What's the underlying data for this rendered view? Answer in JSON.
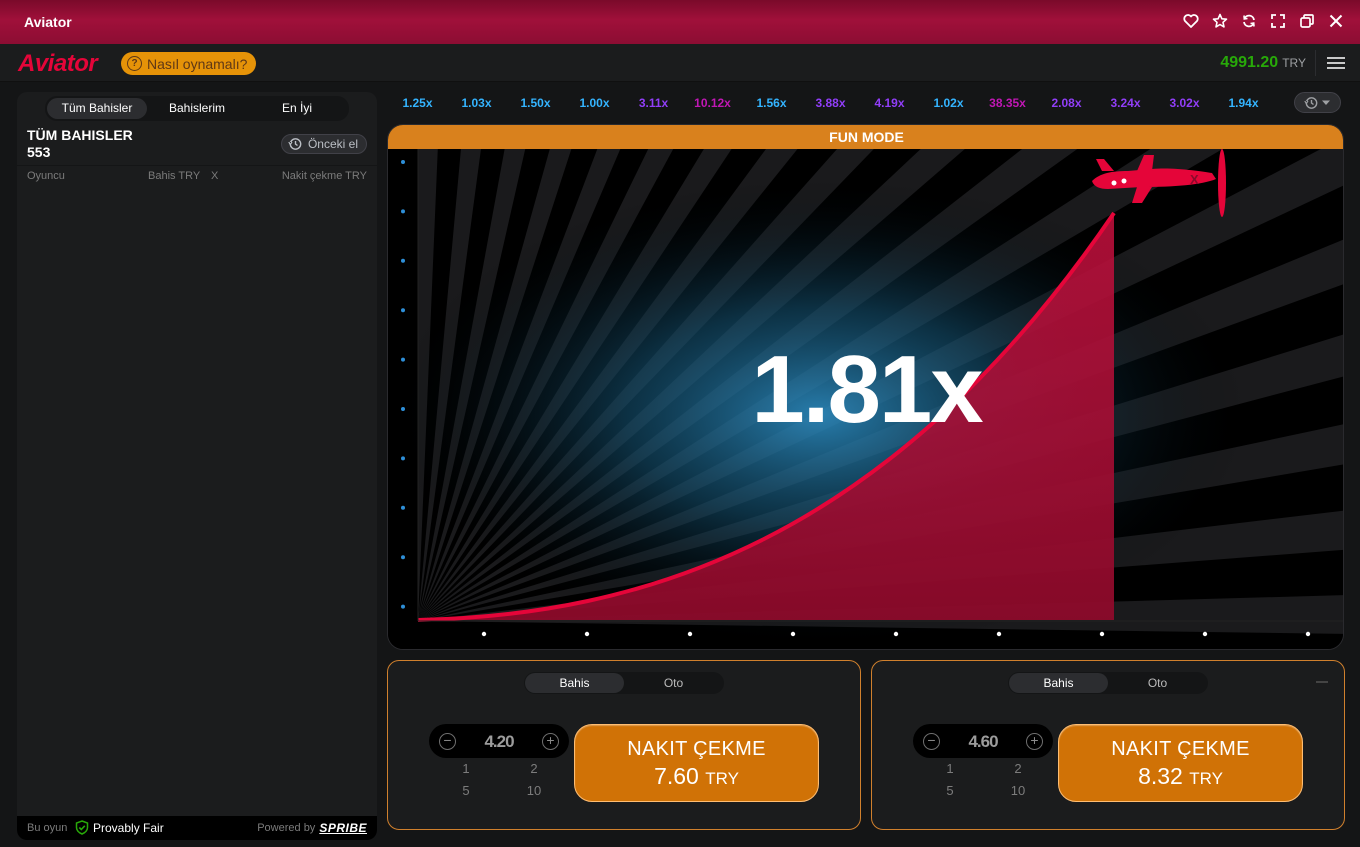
{
  "window": {
    "title": "Aviator"
  },
  "header": {
    "logo": "Aviator",
    "how_to_play": "Nasıl oynamalı?",
    "balance": "4991.20",
    "currency": "TRY"
  },
  "left_panel": {
    "tabs": [
      {
        "label": "Tüm Bahisler",
        "active": true
      },
      {
        "label": "Bahislerim",
        "active": false
      },
      {
        "label": "En İyi",
        "active": false
      }
    ],
    "title": "TÜM BAHISLER",
    "count": "553",
    "previous_hand": "Önceki el",
    "columns": {
      "player": "Oyuncu",
      "bet": "Bahis TRY",
      "x": "X",
      "cashout": "Nakit çekme TRY"
    },
    "footer": {
      "this_game": "Bu oyun",
      "provably_fair": "Provably Fair",
      "powered_by": "Powered by",
      "brand": "SPRIBE"
    }
  },
  "history": [
    {
      "value": "1.25x",
      "color": "#34b4ff"
    },
    {
      "value": "1.03x",
      "color": "#34b4ff"
    },
    {
      "value": "1.50x",
      "color": "#34b4ff"
    },
    {
      "value": "1.00x",
      "color": "#34b4ff"
    },
    {
      "value": "3.11x",
      "color": "#913ef8"
    },
    {
      "value": "10.12x",
      "color": "#c017b4"
    },
    {
      "value": "1.56x",
      "color": "#34b4ff"
    },
    {
      "value": "3.88x",
      "color": "#913ef8"
    },
    {
      "value": "4.19x",
      "color": "#913ef8"
    },
    {
      "value": "1.02x",
      "color": "#34b4ff"
    },
    {
      "value": "38.35x",
      "color": "#c017b4"
    },
    {
      "value": "2.08x",
      "color": "#913ef8"
    },
    {
      "value": "3.24x",
      "color": "#913ef8"
    },
    {
      "value": "3.02x",
      "color": "#913ef8"
    },
    {
      "value": "1.94x",
      "color": "#34b4ff"
    }
  ],
  "game": {
    "mode_banner": "FUN MODE",
    "multiplier": "1.81x",
    "accent_color": "#e50539"
  },
  "bets": [
    {
      "tabs": [
        "Bahis",
        "Oto"
      ],
      "amount": "4.20",
      "quick": [
        "1",
        "2",
        "5",
        "10"
      ],
      "cashout_label": "NAKIT ÇEKME",
      "cashout_amount": "7.60",
      "cashout_currency": "TRY"
    },
    {
      "tabs": [
        "Bahis",
        "Oto"
      ],
      "amount": "4.60",
      "quick": [
        "1",
        "2",
        "5",
        "10"
      ],
      "cashout_label": "NAKIT ÇEKME",
      "cashout_amount": "8.32",
      "cashout_currency": "TRY"
    }
  ]
}
